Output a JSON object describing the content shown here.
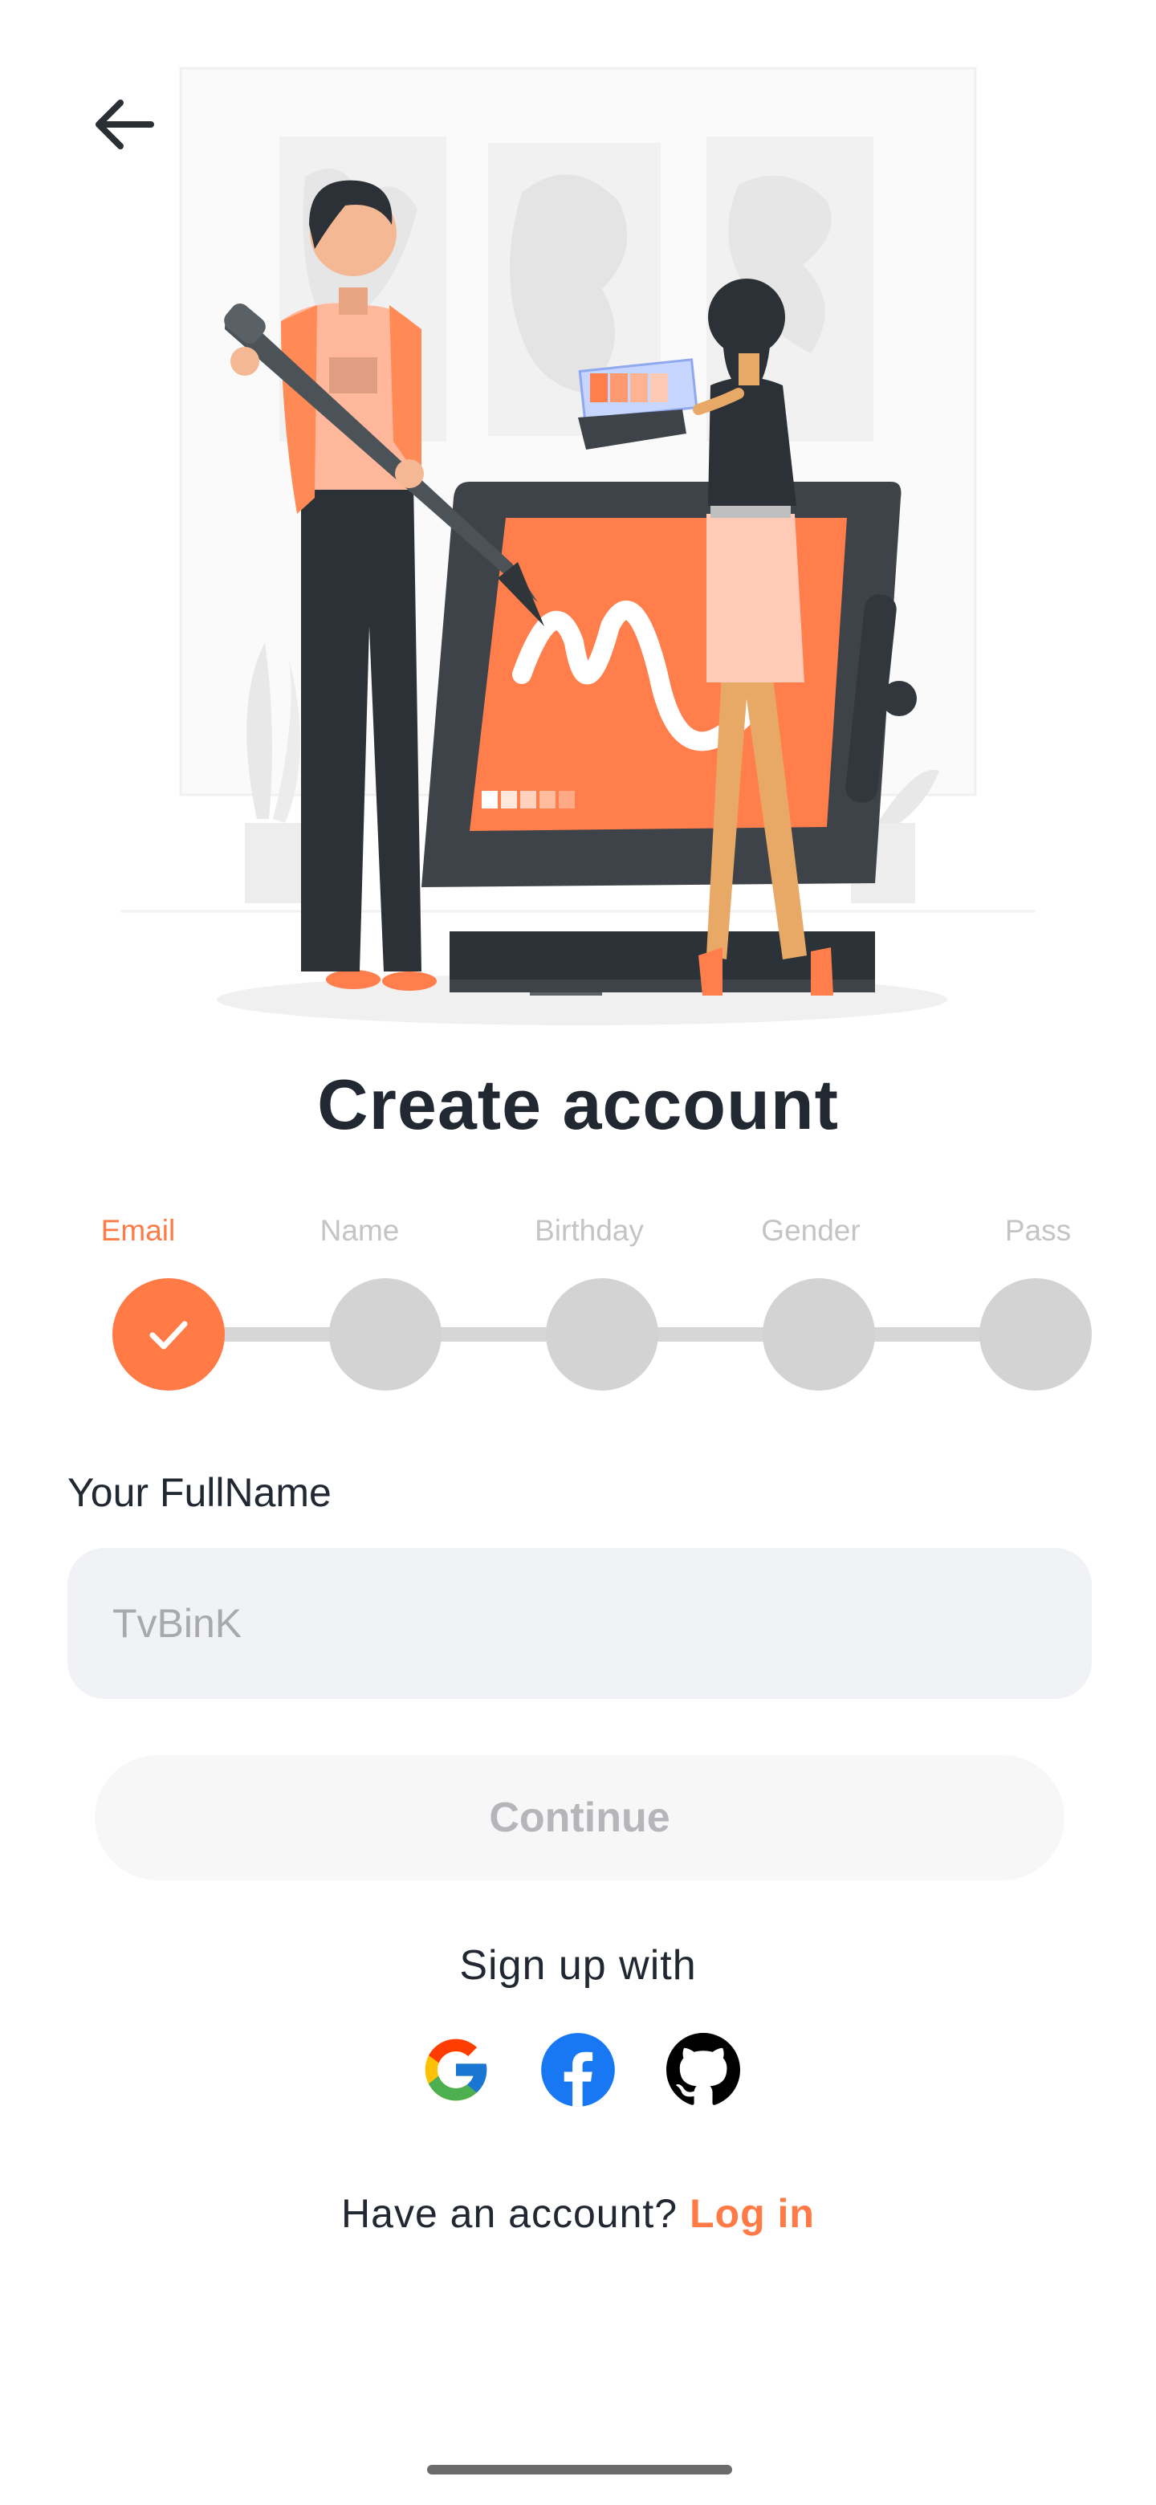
{
  "header": {
    "back_icon": "arrow-left-icon"
  },
  "hero": {
    "illustration": "designers-at-drawing-tablet-illustration"
  },
  "title": "Create account",
  "steps": [
    {
      "label": "Email",
      "state": "done"
    },
    {
      "label": "Name",
      "state": "pending"
    },
    {
      "label": "Birthday",
      "state": "pending"
    },
    {
      "label": "Gender",
      "state": "pending"
    },
    {
      "label": "Pass",
      "state": "pending"
    }
  ],
  "form": {
    "label": "Your FullName",
    "value": "",
    "placeholder": "TvBinK"
  },
  "continue_label": "Continue",
  "signup_with": "Sign up with",
  "social": [
    {
      "name": "google",
      "icon": "google-icon"
    },
    {
      "name": "facebook",
      "icon": "facebook-icon"
    },
    {
      "name": "github",
      "icon": "github-icon"
    }
  ],
  "login": {
    "prompt": "Have an account?",
    "link": "Log in"
  },
  "colors": {
    "accent": "#ff7a45",
    "text": "#222831",
    "inactive": "#d3d3d3",
    "input_bg": "#f1f2f6"
  }
}
